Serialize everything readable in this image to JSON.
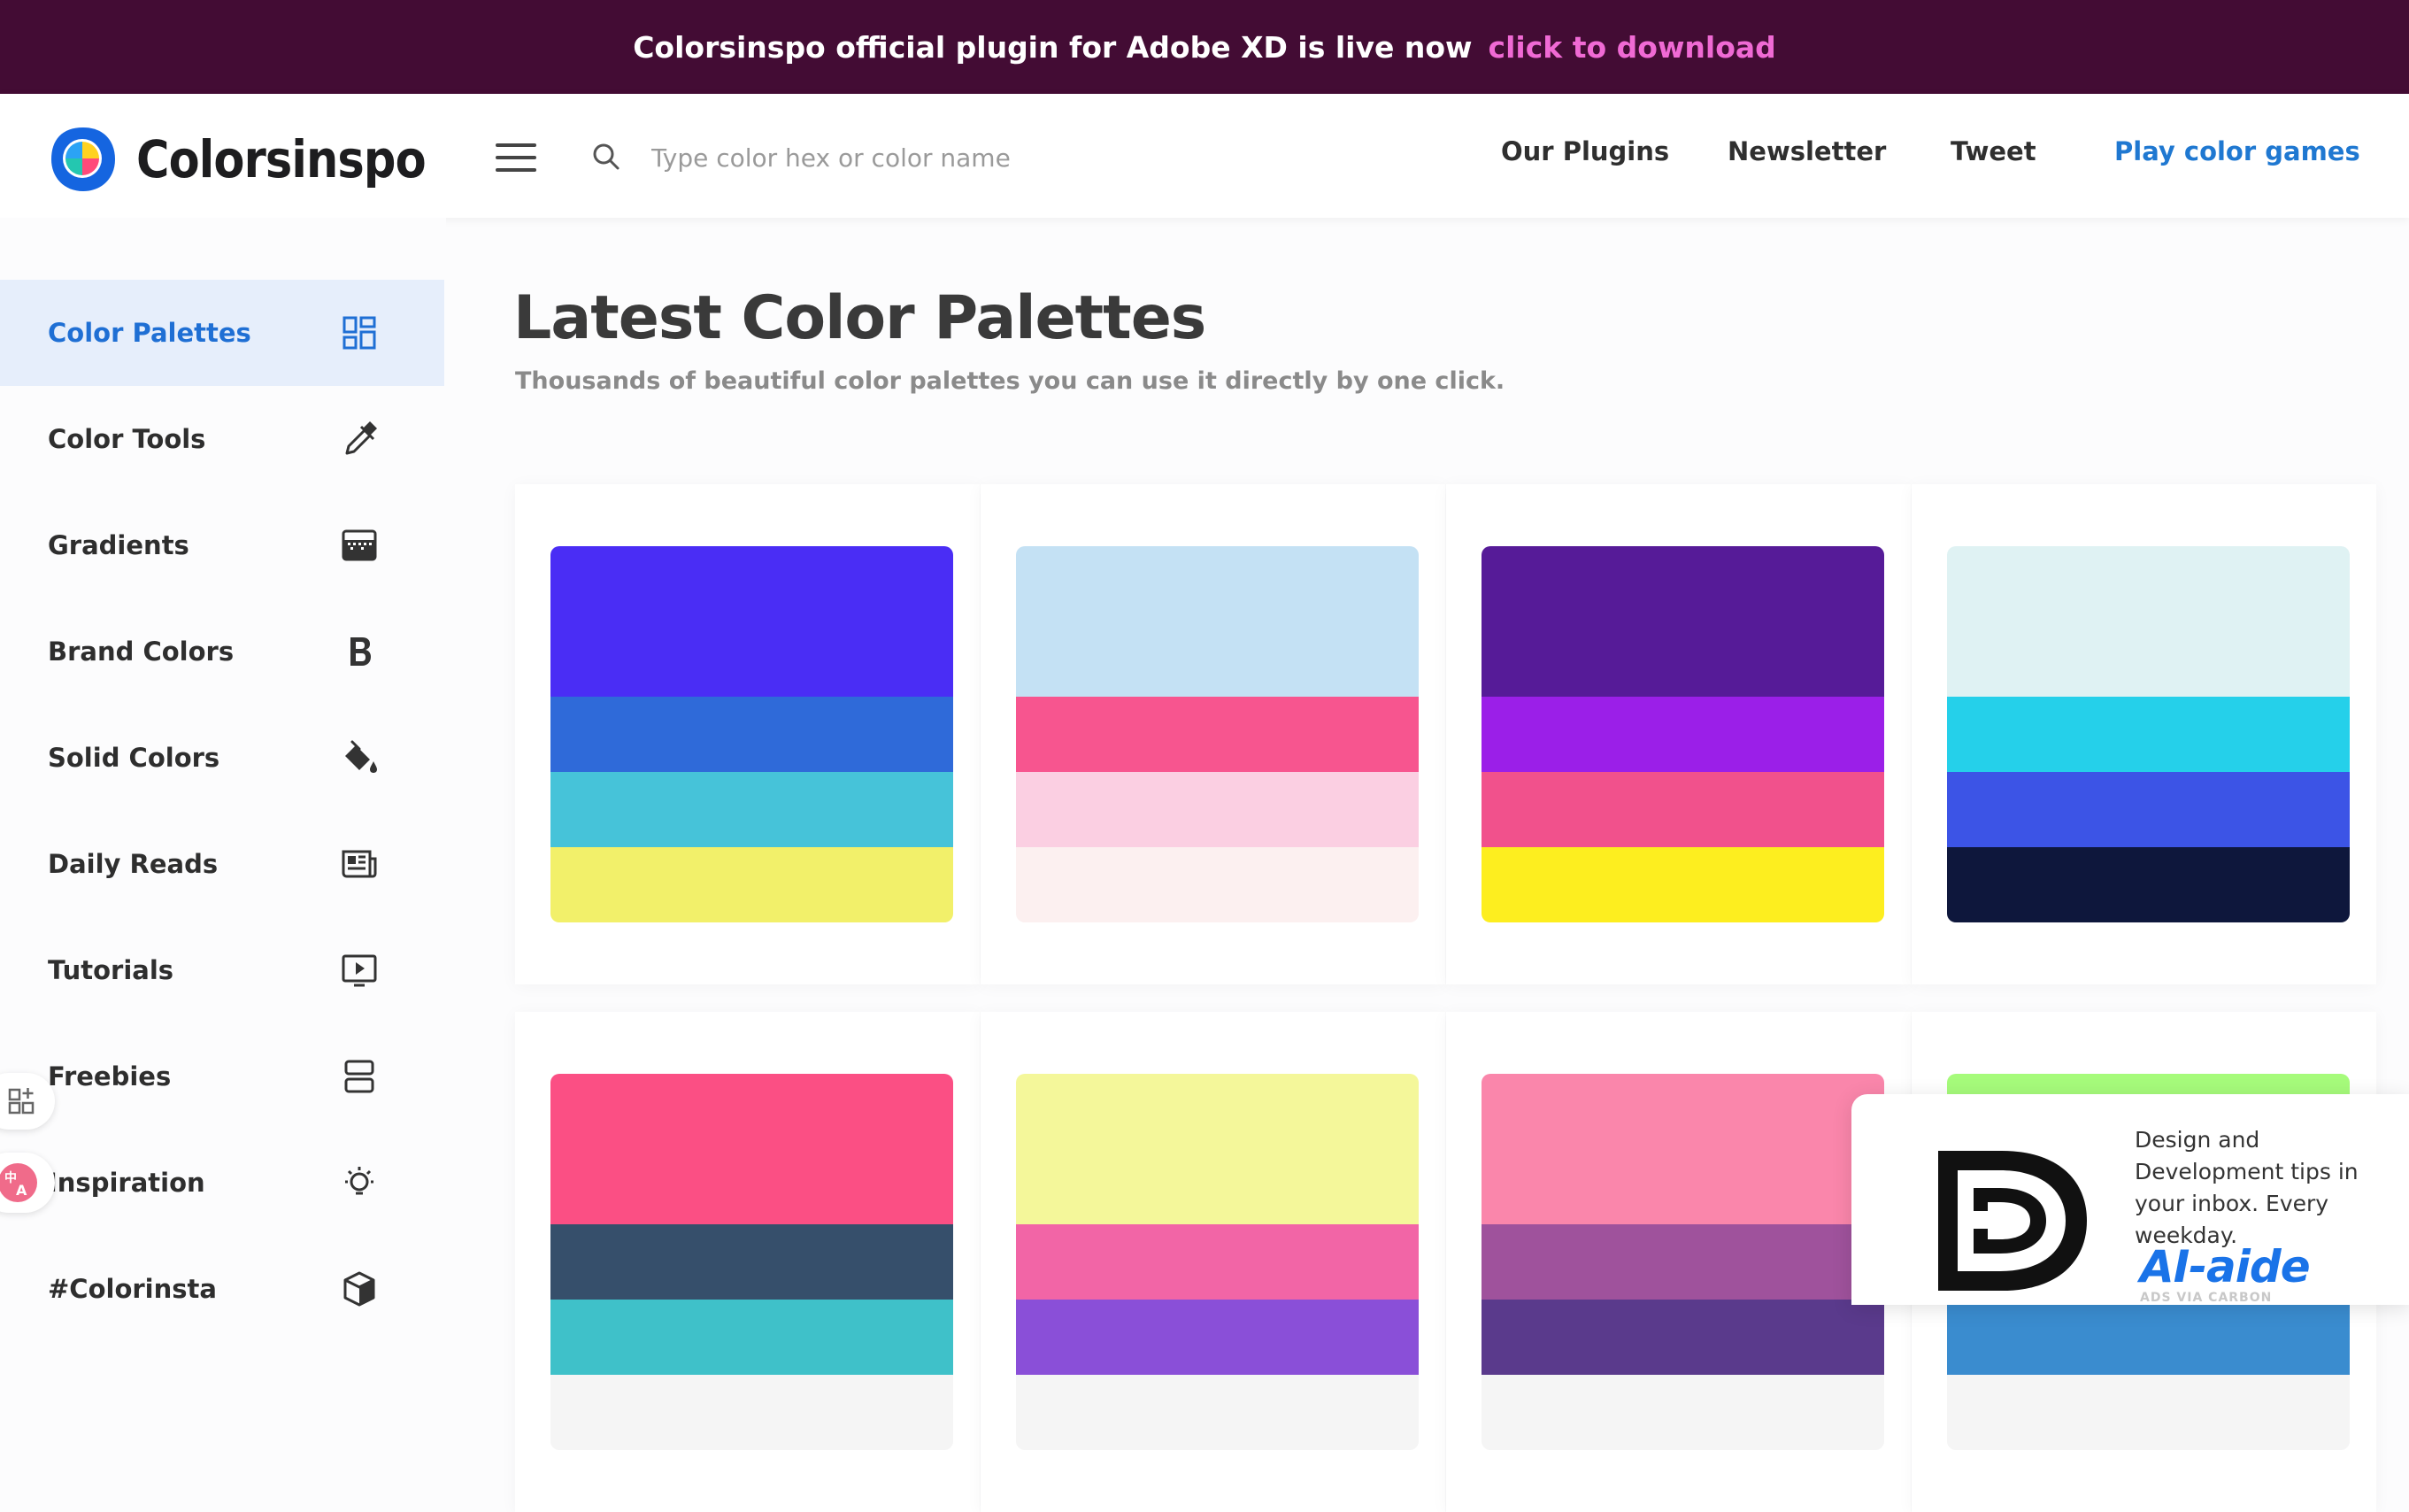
{
  "banner": {
    "text": "Colorsinspo official plugin for Adobe XD is live now",
    "link": "click to download"
  },
  "header": {
    "logo_text": "Colorsinspo",
    "search_placeholder": "Type color hex or color name",
    "nav": {
      "plugins": "Our Plugins",
      "newsletter": "Newsletter",
      "tweet": "Tweet",
      "games": "Play color games"
    },
    "accent_color": "#1f78d1"
  },
  "sidebar": {
    "items": [
      {
        "label": "Color Palettes",
        "icon": "grid-icon",
        "active": true
      },
      {
        "label": "Color Tools",
        "icon": "eyedropper-icon"
      },
      {
        "label": "Gradients",
        "icon": "gradient-icon"
      },
      {
        "label": "Brand Colors",
        "icon": "bold-b-icon"
      },
      {
        "label": "Solid Colors",
        "icon": "paint-bucket-icon"
      },
      {
        "label": "Daily Reads",
        "icon": "newspaper-icon"
      },
      {
        "label": "Tutorials",
        "icon": "play-screen-icon"
      },
      {
        "label": "Freebies",
        "icon": "stack-icon"
      },
      {
        "label": "Inspiration",
        "icon": "lightbulb-icon"
      },
      {
        "label": "#Colorinsta",
        "icon": "cube-icon"
      }
    ]
  },
  "main": {
    "title": "Latest Color Palettes",
    "subtitle": "Thousands of beautiful color palettes you can use it directly by one click."
  },
  "palettes": [
    {
      "colors": [
        "#4a2df5",
        "#2f6ad9",
        "#46c3d9",
        "#f2f06a"
      ]
    },
    {
      "colors": [
        "#c4e1f4",
        "#f7558f",
        "#fbcfe2",
        "#fcf0f0"
      ]
    },
    {
      "colors": [
        "#561b98",
        "#9b1fe8",
        "#f1518c",
        "#fdee1f"
      ]
    },
    {
      "colors": [
        "#dff2f3",
        "#25d0ea",
        "#3c54e6",
        "#0e173c"
      ]
    },
    {
      "colors": [
        "#fb4f84",
        "#364f6b",
        "#3fc1c9",
        "#f5f5f5"
      ]
    },
    {
      "colors": [
        "#f4f79a",
        "#f265a6",
        "#8a4fd8",
        "#f5f5f5"
      ]
    },
    {
      "colors": [
        "#fa86ab",
        "#9f529c",
        "#5a3a8c",
        "#f5f5f5"
      ]
    },
    {
      "colors": [
        "#a6fb7b",
        "#6ad4a0",
        "#3a8ccf",
        "#f5f5f5"
      ]
    }
  ],
  "ad": {
    "text": "Design and Development tips in your inbox. Every weekday.",
    "brand": "AI-aide",
    "carbon": "ADS VIA CARBON"
  }
}
